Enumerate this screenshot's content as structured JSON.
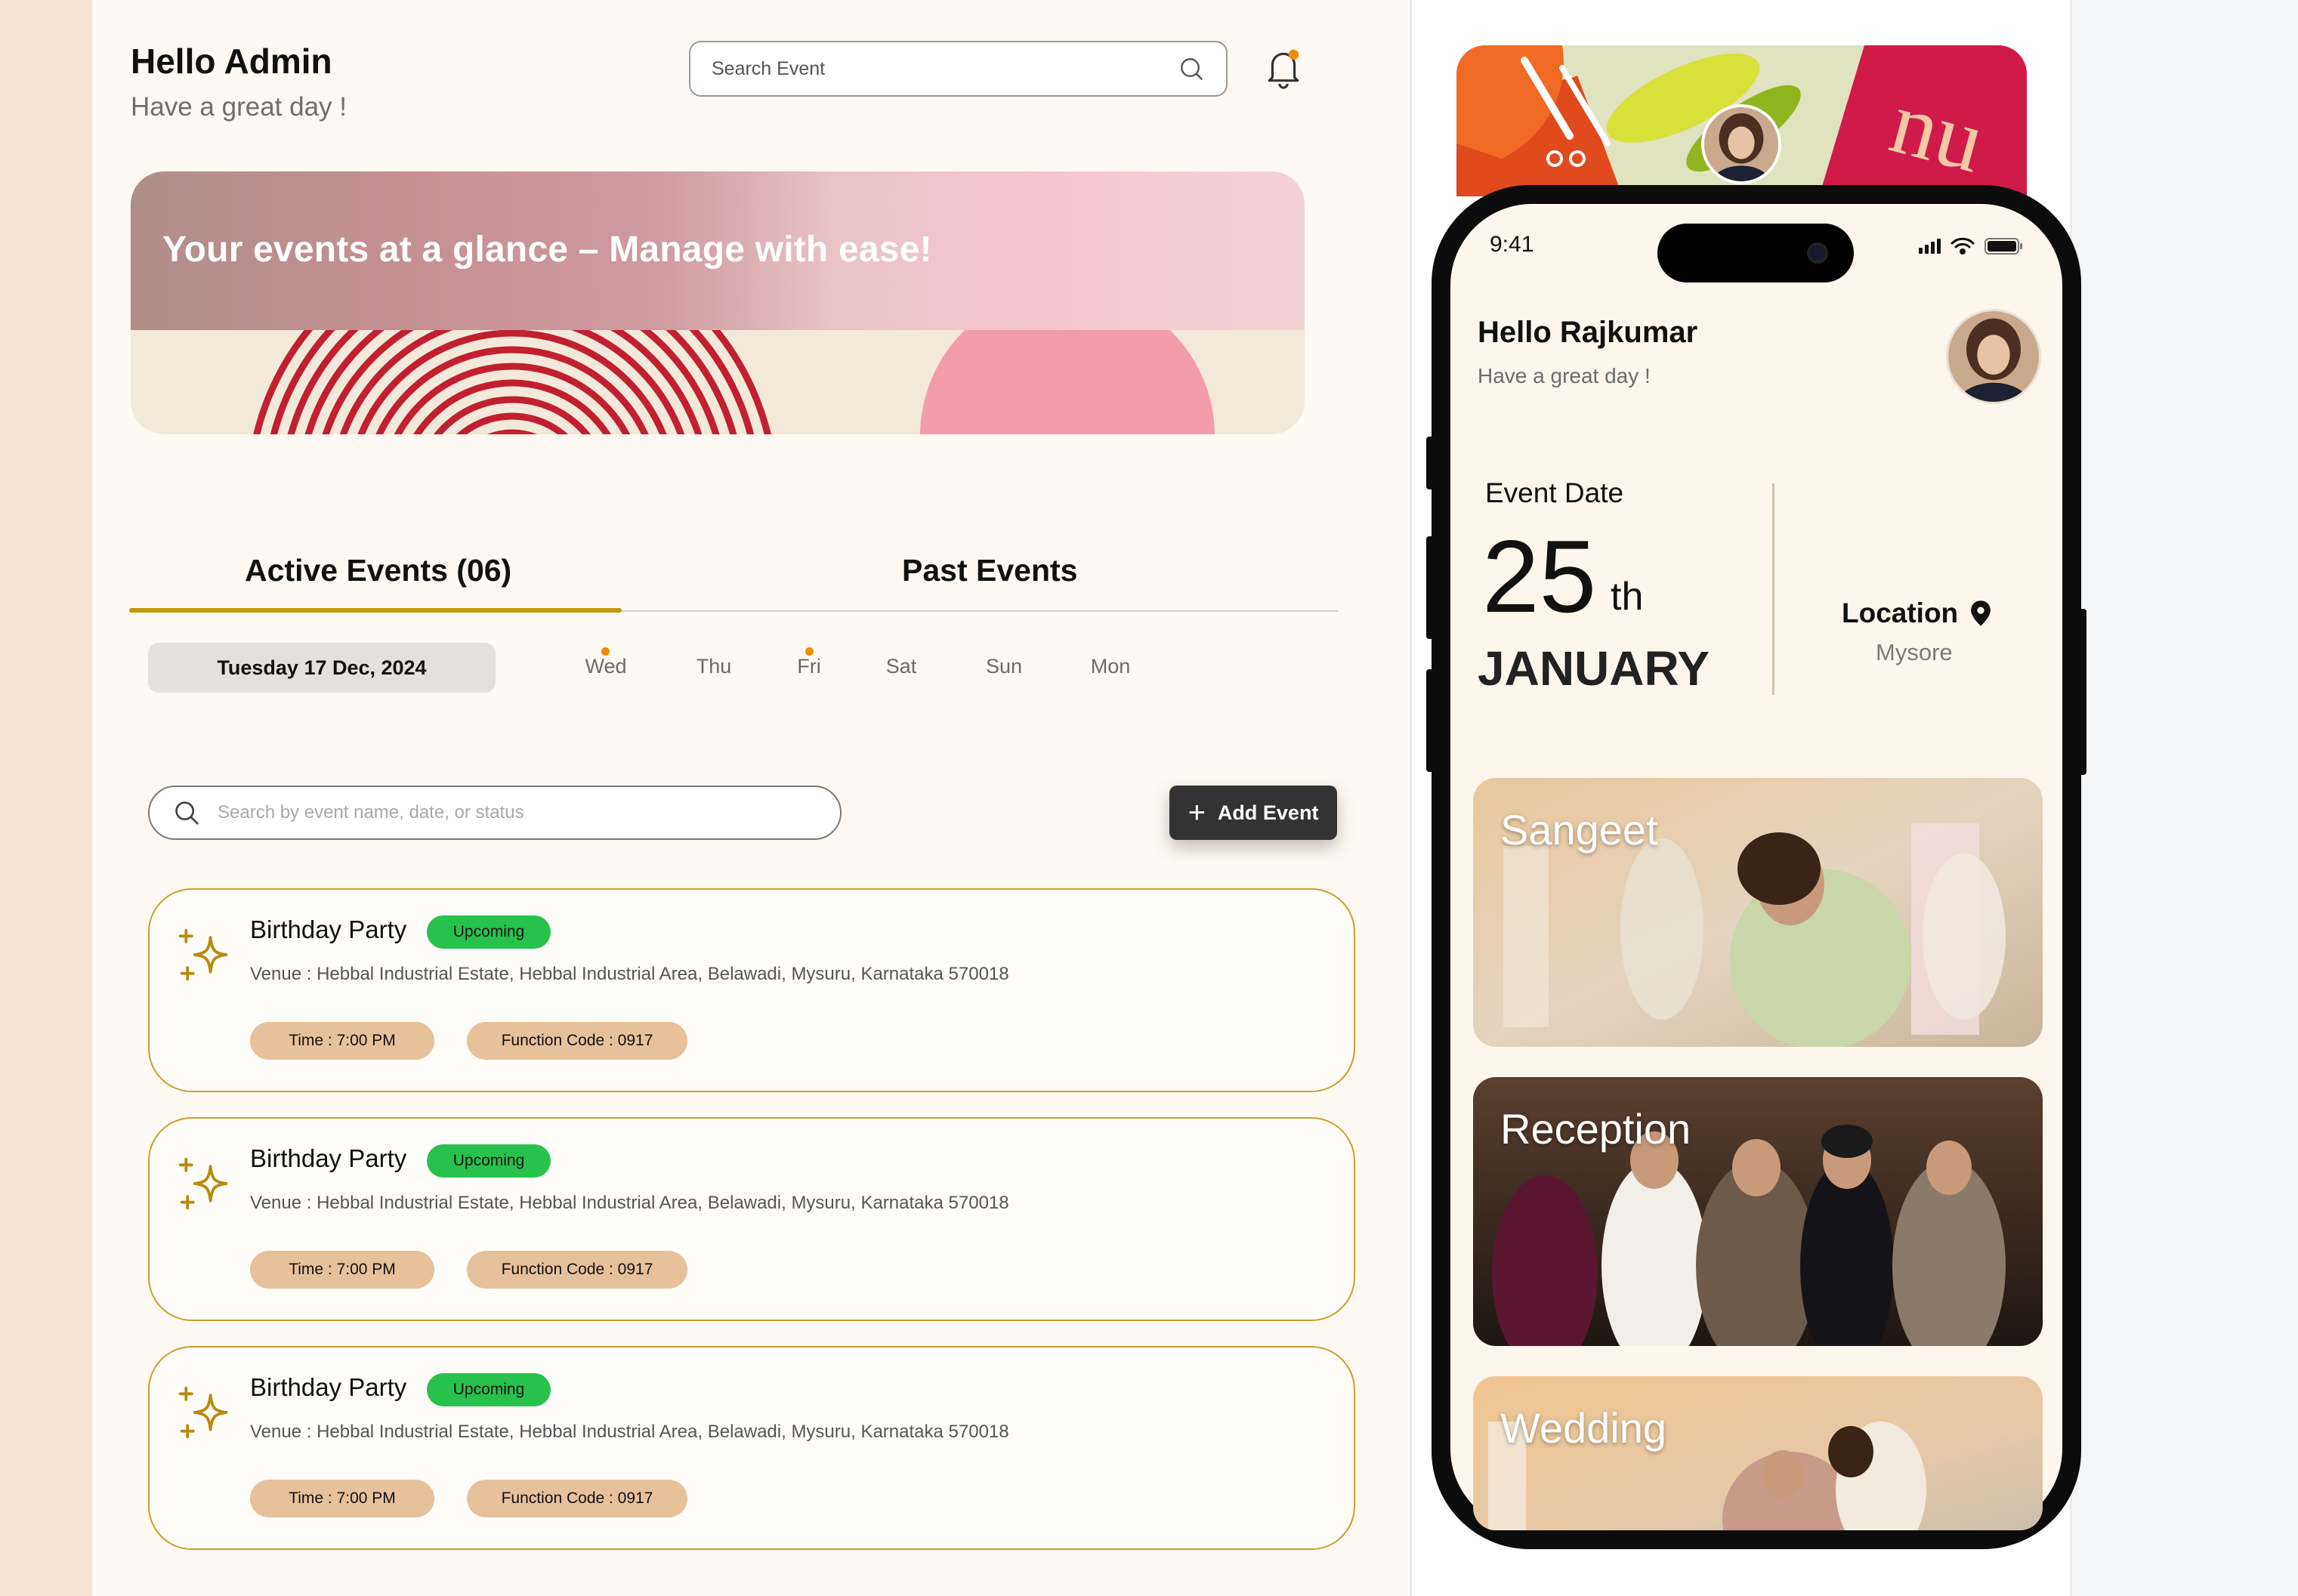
{
  "header": {
    "greeting": "Hello Admin",
    "subtitle": "Have a great day !",
    "search_placeholder": "Search Event"
  },
  "banner": {
    "text": "Your events at a glance – Manage with ease!"
  },
  "tabs": [
    {
      "label": "Active Events (06)",
      "active": true
    },
    {
      "label": "Past Events",
      "active": false
    }
  ],
  "date_selector": {
    "selected": "Tuesday 17 Dec, 2024",
    "days": [
      {
        "label": "Wed",
        "has_event": true
      },
      {
        "label": "Thu",
        "has_event": false
      },
      {
        "label": "Fri",
        "has_event": true
      },
      {
        "label": "Sat",
        "has_event": false
      },
      {
        "label": "Sun",
        "has_event": false
      },
      {
        "label": "Mon",
        "has_event": false
      }
    ]
  },
  "event_search": {
    "placeholder": "Search by event name, date, or status"
  },
  "add_event": {
    "label": "Add Event"
  },
  "events": [
    {
      "title": "Birthday Party",
      "status": "Upcoming",
      "venue": "Venue : Hebbal Industrial Estate, Hebbal Industrial Area, Belawadi, Mysuru, Karnataka 570018",
      "time": "Time : 7:00 PM",
      "code": "Function Code : 0917"
    },
    {
      "title": "Birthday Party",
      "status": "Upcoming",
      "venue": "Venue : Hebbal Industrial Estate, Hebbal Industrial Area, Belawadi, Mysuru, Karnataka 570018",
      "time": "Time : 7:00 PM",
      "code": "Function Code : 0917"
    },
    {
      "title": "Birthday Party",
      "status": "Upcoming",
      "venue": "Venue : Hebbal Industrial Estate, Hebbal Industrial Area, Belawadi, Mysuru, Karnataka 570018",
      "time": "Time : 7:00 PM",
      "code": "Function Code : 0917"
    }
  ],
  "phone": {
    "status_time": "9:41",
    "greeting": "Hello Rajkumar",
    "subtitle": "Have a great day !",
    "event_date_label": "Event Date",
    "day": "25",
    "day_suffix": "th",
    "month": "JANUARY",
    "location_label": "Location",
    "location_value": "Mysore",
    "event_cards": [
      "Sangeet",
      "Reception",
      "Wedding"
    ]
  },
  "colors": {
    "accent_gold": "#c7950b",
    "status_green": "#27c24c",
    "pill_tan": "#e7c19a",
    "page_bg": "#fef9f2",
    "dark_button": "#333333"
  },
  "icons": [
    "search-icon",
    "bell-icon",
    "sparkle-icon",
    "plus-icon",
    "location-pin-icon",
    "signal-icon",
    "wifi-icon",
    "battery-icon"
  ]
}
